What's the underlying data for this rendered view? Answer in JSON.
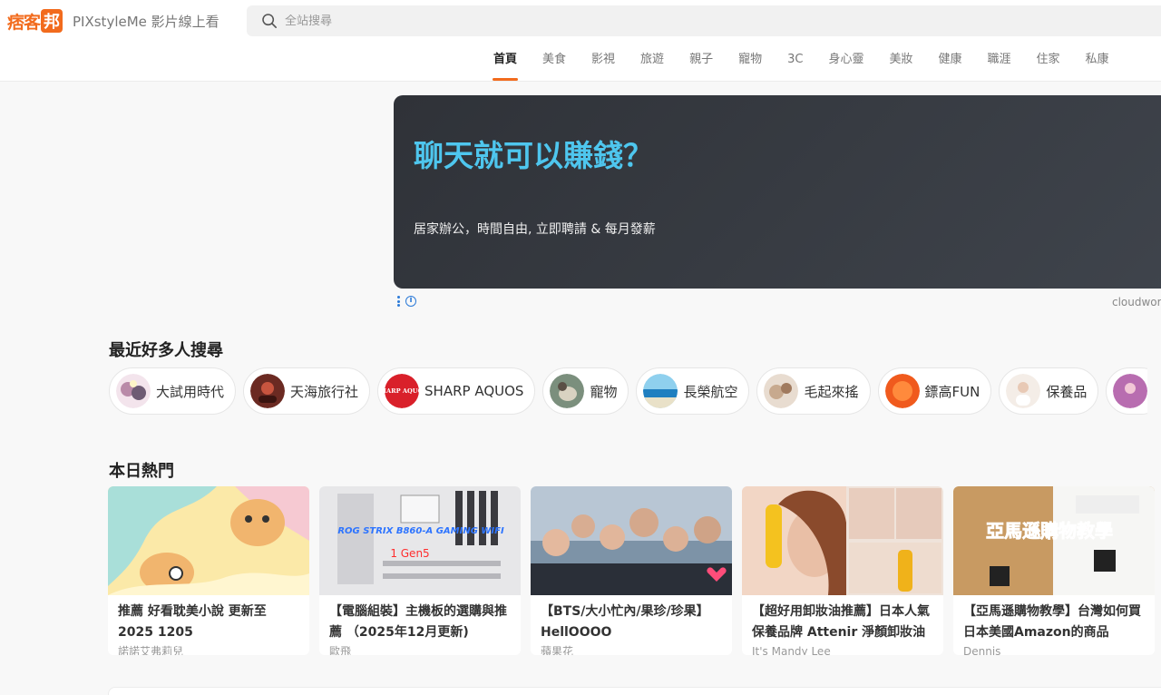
{
  "header": {
    "logo_text": "痞客",
    "logo_box": "邦",
    "promo_link": "PIXstyleMe 影片線上看",
    "search_placeholder": "全站搜尋"
  },
  "nav": {
    "items": [
      {
        "label": "首頁",
        "active": true
      },
      {
        "label": "美食"
      },
      {
        "label": "影視"
      },
      {
        "label": "旅遊"
      },
      {
        "label": "親子"
      },
      {
        "label": "寵物"
      },
      {
        "label": "3C"
      },
      {
        "label": "身心靈"
      },
      {
        "label": "美妝"
      },
      {
        "label": "健康"
      },
      {
        "label": "職涯"
      },
      {
        "label": "住家"
      },
      {
        "label": "私康"
      }
    ]
  },
  "ad": {
    "title": "聊天就可以賺錢？",
    "subtitle": "居家辦公，時間自由, 立即聘請 & 每月發薪",
    "info_icon": "i",
    "source": "cloudwork"
  },
  "trending": {
    "title": "最近好多人搜尋",
    "chips": [
      {
        "label": "大試用時代",
        "color": "#b98aa8"
      },
      {
        "label": "天海旅行社",
        "color": "#6b2a22"
      },
      {
        "label": "SHARP AQUOS",
        "color": "#d9202a",
        "avatar_text": "SHARP AQUOS"
      },
      {
        "label": "寵物",
        "color": "#7b8f7d"
      },
      {
        "label": "長榮航空",
        "color": "#2a8fc9"
      },
      {
        "label": "毛起來搖",
        "color": "#c7a98e"
      },
      {
        "label": "鏢高FUN",
        "color": "#f05a1d"
      },
      {
        "label": "保養品",
        "color": "#e8d9cf"
      },
      {
        "label": "",
        "color": "#b86db0"
      }
    ]
  },
  "hot": {
    "title": "本日熱門",
    "articles": [
      {
        "title": "推薦 好看耽美小說 更新至 2025 1205",
        "author": "諾諾艾弗莉兒"
      },
      {
        "title": "【電腦組裝】主機板的選購與推薦 （2025年12月更新)",
        "author": "歐飛",
        "thumb_text": "ROG STRIX B860-A GAMING WIFI",
        "thumb_sub": "1 Gen5"
      },
      {
        "title": "【BTS/大小忙內/果珍/珍果】HellOOOO",
        "author": "蘋果花"
      },
      {
        "title": "【超好用卸妝油推薦】日本人氣保養品牌 Attenir 淨顏卸妝油",
        "author": "It's Mandy Lee"
      },
      {
        "title": "【亞馬遜購物教學】台灣如何買日本美國Amazon的商品",
        "author": "Dennis",
        "thumb_text": "亞馬遜購物教學"
      }
    ]
  }
}
